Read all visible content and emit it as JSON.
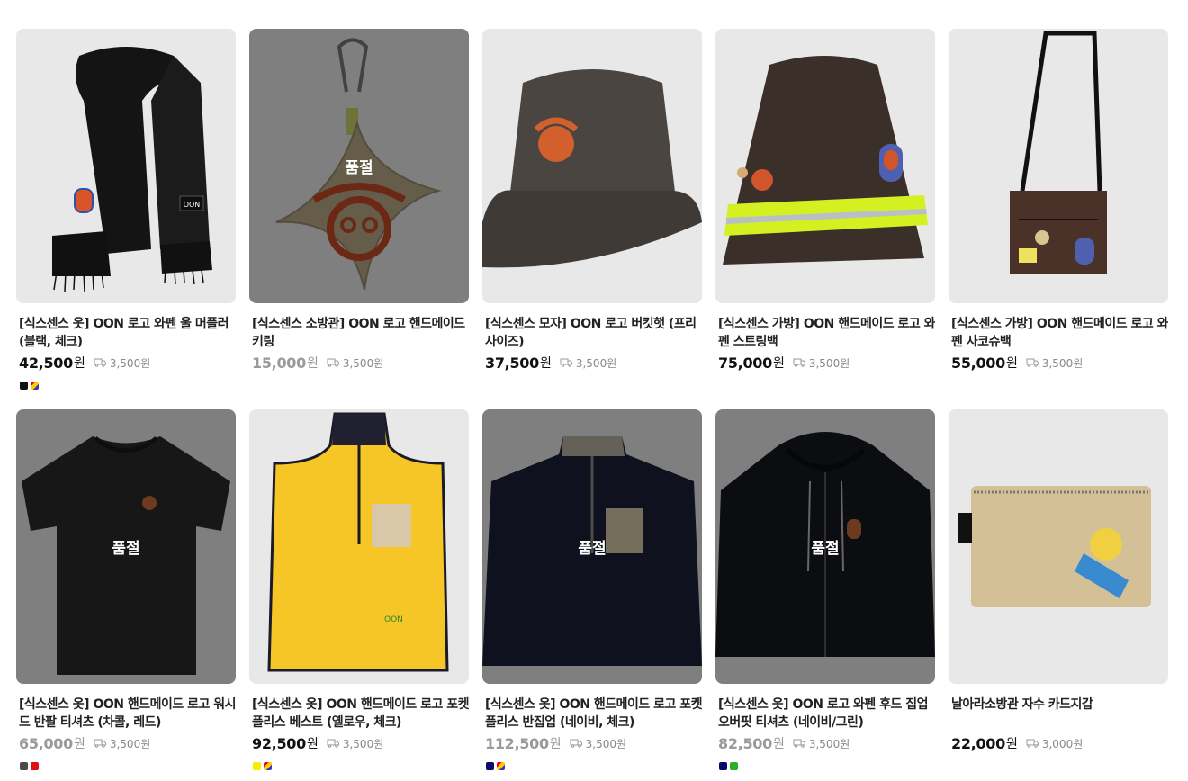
{
  "products": [
    {
      "title": "[식스센스 옷] OON 로고 와펜 울 머플러 (블랙, 체크)",
      "price": "42,500",
      "won": "원",
      "shipping": "3,500원",
      "soldout": false,
      "swatches": [
        "#111111",
        "multi"
      ],
      "image": "scarf"
    },
    {
      "title": "[식스센스 소방관] OON 로고 핸드메이드 키링",
      "price": "15,000",
      "won": "원",
      "shipping": "3,500원",
      "soldout": true,
      "soldout_label": "품절",
      "swatches": [],
      "image": "keyring"
    },
    {
      "title": "[식스센스 모자] OON 로고 버킷햇 (프리사이즈)",
      "price": "37,500",
      "won": "원",
      "shipping": "3,500원",
      "soldout": false,
      "swatches": [],
      "image": "buckethat"
    },
    {
      "title": "[식스센스 가방] OON 핸드메이드 로고 와펜 스트링백",
      "price": "75,000",
      "won": "원",
      "shipping": "3,500원",
      "soldout": false,
      "swatches": [],
      "image": "stringbag"
    },
    {
      "title": "[식스센스 가방] OON 핸드메이드 로고 와펜 사코슈백",
      "price": "55,000",
      "won": "원",
      "shipping": "3,500원",
      "soldout": false,
      "swatches": [],
      "image": "sacoche"
    },
    {
      "title": "[식스센스 옷] OON 핸드메이드 로고 워시드 반팔 티셔츠 (차콜, 레드)",
      "price": "65,000",
      "won": "원",
      "shipping": "3,500원",
      "soldout": true,
      "soldout_label": "품절",
      "swatches": [
        "#4a4a4a",
        "#e01010"
      ],
      "image": "tshirt"
    },
    {
      "title": "[식스센스 옷] OON 핸드메이드 로고 포켓 플리스 베스트 (옐로우, 체크)",
      "price": "92,500",
      "won": "원",
      "shipping": "3,500원",
      "soldout": false,
      "swatches": [
        "#f5ee00",
        "multi"
      ],
      "image": "vest"
    },
    {
      "title": "[식스센스 옷] OON 핸드메이드 로고 포켓 플리스 반집업 (네이비, 체크)",
      "price": "112,500",
      "won": "원",
      "shipping": "3,500원",
      "soldout": true,
      "soldout_label": "품절",
      "swatches": [
        "#0a0a6a",
        "multi"
      ],
      "image": "halfzip"
    },
    {
      "title": "[식스센스 옷] OON 로고 와펜 후드 집업 오버핏 티셔츠 (네이비/그린)",
      "price": "82,500",
      "won": "원",
      "shipping": "3,500원",
      "soldout": true,
      "soldout_label": "품절",
      "swatches": [
        "#0a0a6a",
        "#2cb02c"
      ],
      "image": "hoodie"
    },
    {
      "title": "날아라소방관 자수 카드지갑",
      "price": "22,000",
      "won": "원",
      "shipping": "3,000원",
      "soldout": false,
      "swatches": [],
      "image": "cardwallet"
    }
  ],
  "icons": {
    "shipping": "truck-icon"
  }
}
